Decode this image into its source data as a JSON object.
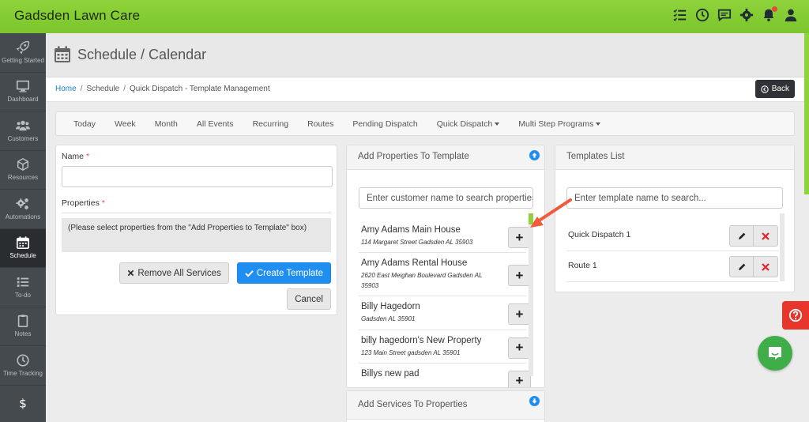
{
  "app": {
    "title": "Gadsden Lawn Care"
  },
  "topbar": {
    "icons": [
      "checklist-icon",
      "clock-icon",
      "chat-icon",
      "gear-icon",
      "bell-icon",
      "user-icon"
    ]
  },
  "sidebar": {
    "items": [
      {
        "label": "Getting Started",
        "icon": "rocket-icon"
      },
      {
        "label": "Dashboard",
        "icon": "monitor-icon"
      },
      {
        "label": "Customers",
        "icon": "users-icon"
      },
      {
        "label": "Resources",
        "icon": "cube-icon"
      },
      {
        "label": "Automations",
        "icon": "gears-icon"
      },
      {
        "label": "Schedule",
        "icon": "calendar-icon",
        "active": true
      },
      {
        "label": "To-do",
        "icon": "list-icon"
      },
      {
        "label": "Notes",
        "icon": "clipboard-icon"
      },
      {
        "label": "Time Tracking",
        "icon": "clock-icon"
      },
      {
        "label": "",
        "icon": "dollar-icon"
      }
    ]
  },
  "header": {
    "title": "Schedule / Calendar"
  },
  "breadcrumb": {
    "home": "Home",
    "schedule": "Schedule",
    "current": "Quick Dispatch - Template Management"
  },
  "back_button": {
    "label": "Back"
  },
  "nav": {
    "tabs": [
      "Today",
      "Week",
      "Month",
      "All Events",
      "Recurring",
      "Routes",
      "Pending Dispatch"
    ],
    "dropdowns": [
      "Quick Dispatch",
      "Multi Step Programs"
    ]
  },
  "form": {
    "name_label": "Name",
    "required_mark": "*",
    "name_value": "",
    "properties_label": "Properties",
    "properties_hint": "(Please select properties from the \"Add Properties to Template\" box)",
    "remove_all_label": "Remove All Services",
    "create_label": "Create Template",
    "cancel_label": "Cancel"
  },
  "add_properties": {
    "title": "Add Properties To Template",
    "search_placeholder": "Enter customer name to search properties",
    "items": [
      {
        "name": "Amy Adams Main House",
        "address": "114 Margaret Street Gadsden AL 35903"
      },
      {
        "name": "Amy Adams Rental House",
        "address": "2620 East Meighan Boulevard Gadsden AL 35903"
      },
      {
        "name": "Billy Hagedorn",
        "address": "Gadsden AL 35901"
      },
      {
        "name": "billy hagedorn's New Property",
        "address": "123 Main Street gadsden AL 35901"
      },
      {
        "name": "Billys new pad",
        "address": ""
      }
    ],
    "add_symbol": "+"
  },
  "add_services": {
    "title": "Add Services To Properties"
  },
  "templates": {
    "title": "Templates List",
    "search_placeholder": "Enter template name to search...",
    "items": [
      {
        "name": "Quick Dispatch 1"
      },
      {
        "name": "Route 1"
      }
    ]
  },
  "colors": {
    "brand_green": "#8ed33a",
    "primary_blue": "#1f8ef1",
    "danger_red": "#e5252a",
    "sidebar": "#454a4f",
    "annotation_arrow": "#f15a3a"
  }
}
